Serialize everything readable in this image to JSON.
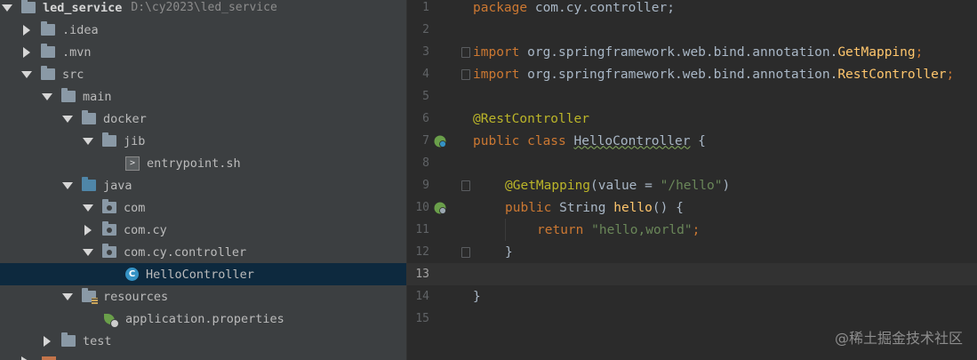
{
  "project": {
    "name": "led_service",
    "path": "D:\\cy2023\\led_service"
  },
  "tree": [
    {
      "label": ".idea"
    },
    {
      "label": ".mvn"
    },
    {
      "label": "src"
    },
    {
      "label": "main"
    },
    {
      "label": "docker"
    },
    {
      "label": "jib"
    },
    {
      "label": "entrypoint.sh"
    },
    {
      "label": "java"
    },
    {
      "label": "com"
    },
    {
      "label": "com.cy"
    },
    {
      "label": "com.cy.controller"
    },
    {
      "label": "HelloController"
    },
    {
      "label": "resources"
    },
    {
      "label": "application.properties"
    },
    {
      "label": "test"
    }
  ],
  "icons": {
    "class_letter": "C",
    "sh_glyph": ">"
  },
  "editor": {
    "line_numbers": [
      "1",
      "2",
      "3",
      "4",
      "5",
      "6",
      "7",
      "8",
      "9",
      "10",
      "11",
      "12",
      "13",
      "14",
      "15"
    ],
    "code": {
      "l1_kw": "package",
      "l1_rest": " com.cy.controller;",
      "l3_kw": "import",
      "l3_pkg": " org.springframework.web.bind.annotation.",
      "l3_cls": "GetMapping",
      "l3_end": ";",
      "l4_kw": "import",
      "l4_pkg": " org.springframework.web.bind.annotation.",
      "l4_cls": "RestController",
      "l4_end": ";",
      "l6_ann": "@RestController",
      "l7_kw": "public class",
      "l7_name": "HelloController",
      "l7_end": " {",
      "l9_ann": "@GetMapping",
      "l9_open": "(value = ",
      "l9_str": "\"/hello\"",
      "l9_close": ")",
      "l10_kw": "public",
      "l10_type": " String ",
      "l10_fn": "hello",
      "l10_end": "() {",
      "l11_kw": "return",
      "l11_str": "\"hello,world\"",
      "l11_end": ";",
      "l12": "}",
      "l14": "}"
    }
  },
  "watermark": "@稀土掘金技术社区"
}
